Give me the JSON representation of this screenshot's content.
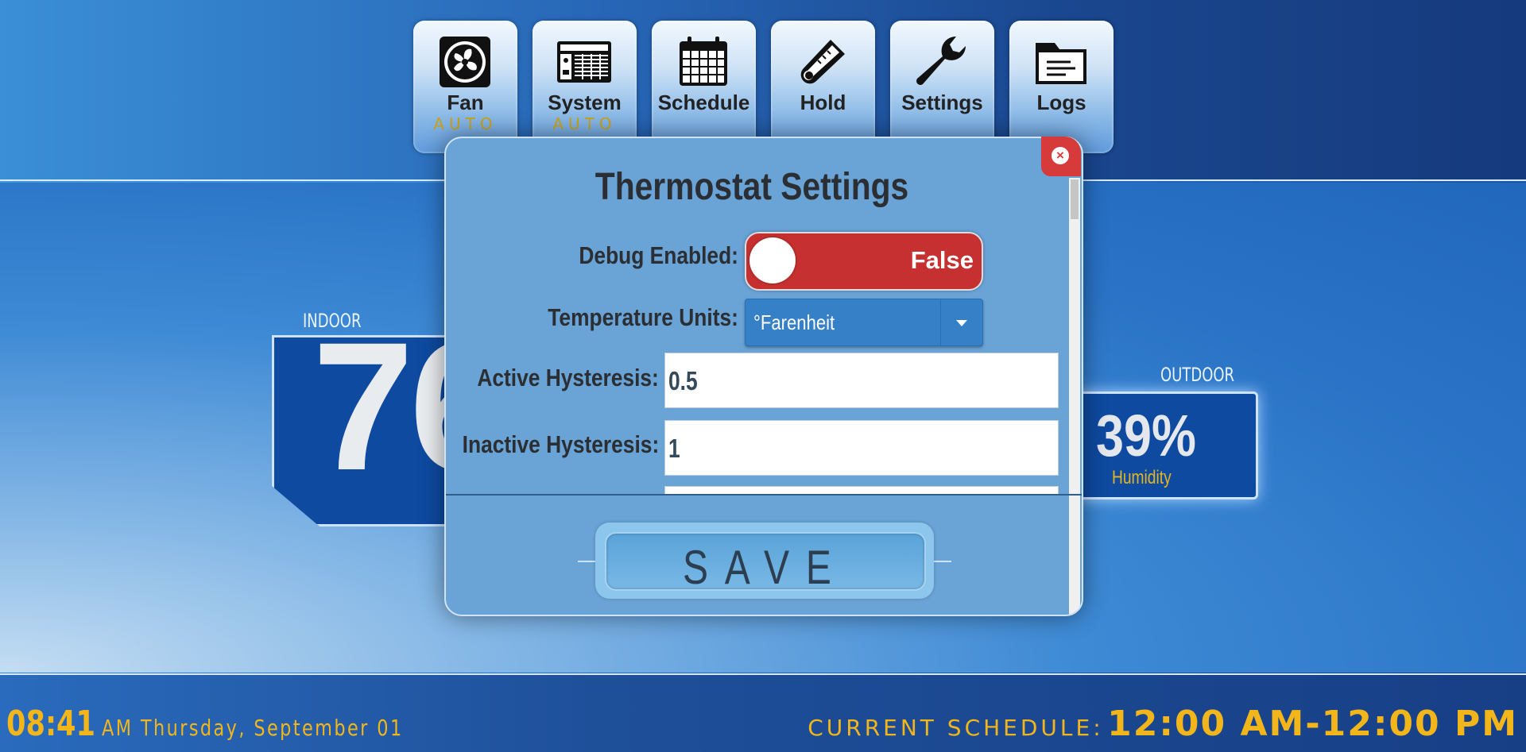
{
  "nav": [
    {
      "label": "Fan",
      "sub": "AUTO",
      "icon": "fan-icon"
    },
    {
      "label": "System",
      "sub": "AUTO",
      "icon": "system-icon"
    },
    {
      "label": "Schedule",
      "sub": "",
      "icon": "calendar-icon"
    },
    {
      "label": "Hold",
      "sub": "",
      "icon": "thermometer-icon"
    },
    {
      "label": "Settings",
      "sub": "",
      "icon": "wrench-icon"
    },
    {
      "label": "Logs",
      "sub": "",
      "icon": "folder-icon"
    }
  ],
  "indoor": {
    "label": "INDOOR",
    "temperature": "76"
  },
  "outdoor": {
    "label": "OUTDOOR",
    "value": "39%",
    "sublabel": "Humidity"
  },
  "modal": {
    "title": "Thermostat Settings",
    "debug_label": "Debug Enabled:",
    "debug_value": "False",
    "units_label": "Temperature Units:",
    "units_value": "°Farenheit",
    "active_label": "Active Hysteresis:",
    "active_value": "0.5",
    "inactive_label": "Inactive Hysteresis:",
    "inactive_value": "1",
    "save_label": "SAVE",
    "close_symbol": "×"
  },
  "footer": {
    "time": "08:41",
    "datetime_rest": "AM Thursday, September 01",
    "schedule_label": "CURRENT SCHEDULE:",
    "schedule_value": "12:00 AM-12:00 PM"
  },
  "colors": {
    "accent": "#f2b61a",
    "toggle_off": "#c63030",
    "close": "#d63a3a"
  }
}
